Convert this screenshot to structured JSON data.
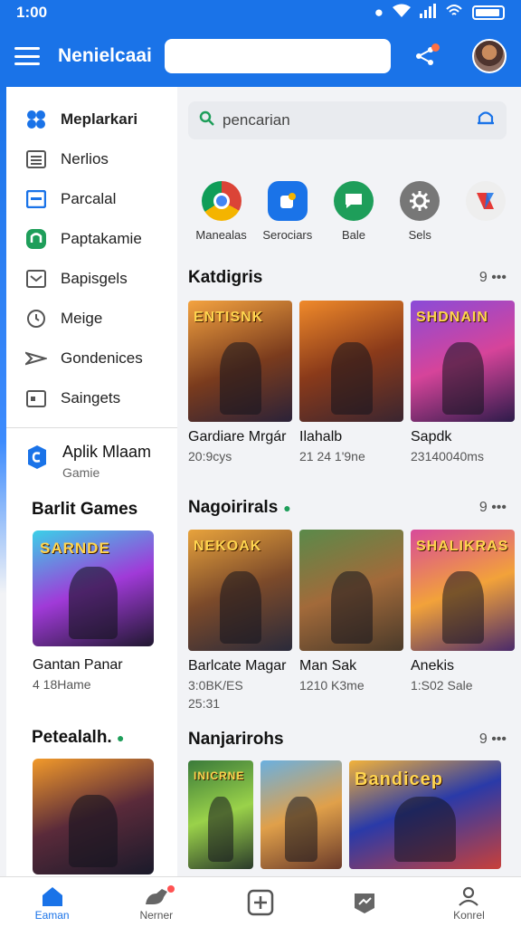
{
  "status": {
    "time": "1:00"
  },
  "appbar": {
    "title": "Nenielcaai",
    "search_placeholder": ""
  },
  "search": {
    "placeholder": "pencarian"
  },
  "sidebar": {
    "items": [
      {
        "label": "Meplarkari",
        "icon": "grid-icon",
        "active": true
      },
      {
        "label": "Nerlios",
        "icon": "list-icon"
      },
      {
        "label": "Parcalal",
        "icon": "card-icon"
      },
      {
        "label": "Paptakamie",
        "icon": "shield-icon"
      },
      {
        "label": "Bapisgels",
        "icon": "mail-icon"
      },
      {
        "label": "Meige",
        "icon": "clock-icon"
      },
      {
        "label": "Gondenices",
        "icon": "plane-icon"
      },
      {
        "label": "Saingets",
        "icon": "calendar-icon"
      }
    ],
    "app": {
      "title": "Aplik Mlaam",
      "subtitle": "Gamie"
    },
    "section1": {
      "title": "Barlit Games",
      "card": {
        "art_title": "SARNDE",
        "title": "Gantan Panar",
        "subtitle": "4 18Hame"
      }
    },
    "section2": {
      "title": "Petealalh."
    }
  },
  "quick": [
    {
      "label": "Manealas",
      "icon": "chrome-icon",
      "color": "#db4437"
    },
    {
      "label": "Serociars",
      "icon": "contacts-icon",
      "color": "#1a73e8"
    },
    {
      "label": "Bale",
      "icon": "chat-icon",
      "color": "#1e9e5a"
    },
    {
      "label": "Sels",
      "icon": "gear-icon",
      "color": "#777777"
    }
  ],
  "sections": [
    {
      "title": "Katdigris",
      "count": "9 •••",
      "dot": false,
      "cards": [
        {
          "art_title": "ENTISNK",
          "title": "Gardiare Mrgár",
          "subtitle": "20:9cys"
        },
        {
          "art_title": "",
          "title": "Ilahalb",
          "subtitle": "21 24 1'9ne"
        },
        {
          "art_title": "SHDNAIN",
          "title": "Sapdk",
          "subtitle": "23140040ms"
        }
      ]
    },
    {
      "title": "Nagoirirals",
      "count": "9 •••",
      "dot": true,
      "cards": [
        {
          "art_title": "NEKOAK",
          "title": "Barlcate Magar",
          "subtitle": "3:0BK/ES",
          "subtitle2": "25:31"
        },
        {
          "art_title": "",
          "title": "Man Sak",
          "subtitle": "1210 K3me"
        },
        {
          "art_title": "SHALIKRAS",
          "title": "Anekis",
          "subtitle": "1:S02 Sale"
        }
      ]
    },
    {
      "title": "Nanjarirohs",
      "count": "9 •••",
      "dot": false,
      "cards": [
        {
          "art_title": "INICRNE",
          "title": "",
          "subtitle": ""
        },
        {
          "art_title": "",
          "title": "",
          "subtitle": ""
        },
        {
          "art_title": "Bandicep",
          "title": "",
          "subtitle": ""
        }
      ]
    }
  ],
  "bottomnav": [
    {
      "label": "Eaman",
      "icon": "home-icon"
    },
    {
      "label": "Nerner",
      "icon": "dino-icon"
    },
    {
      "label": "",
      "icon": "plus-box-icon"
    },
    {
      "label": "",
      "icon": "chart-badge-icon"
    },
    {
      "label": "Konrel",
      "icon": "person-icon"
    }
  ],
  "colors": {
    "primary": "#1a73e8",
    "accent_green": "#1e9e5a"
  }
}
